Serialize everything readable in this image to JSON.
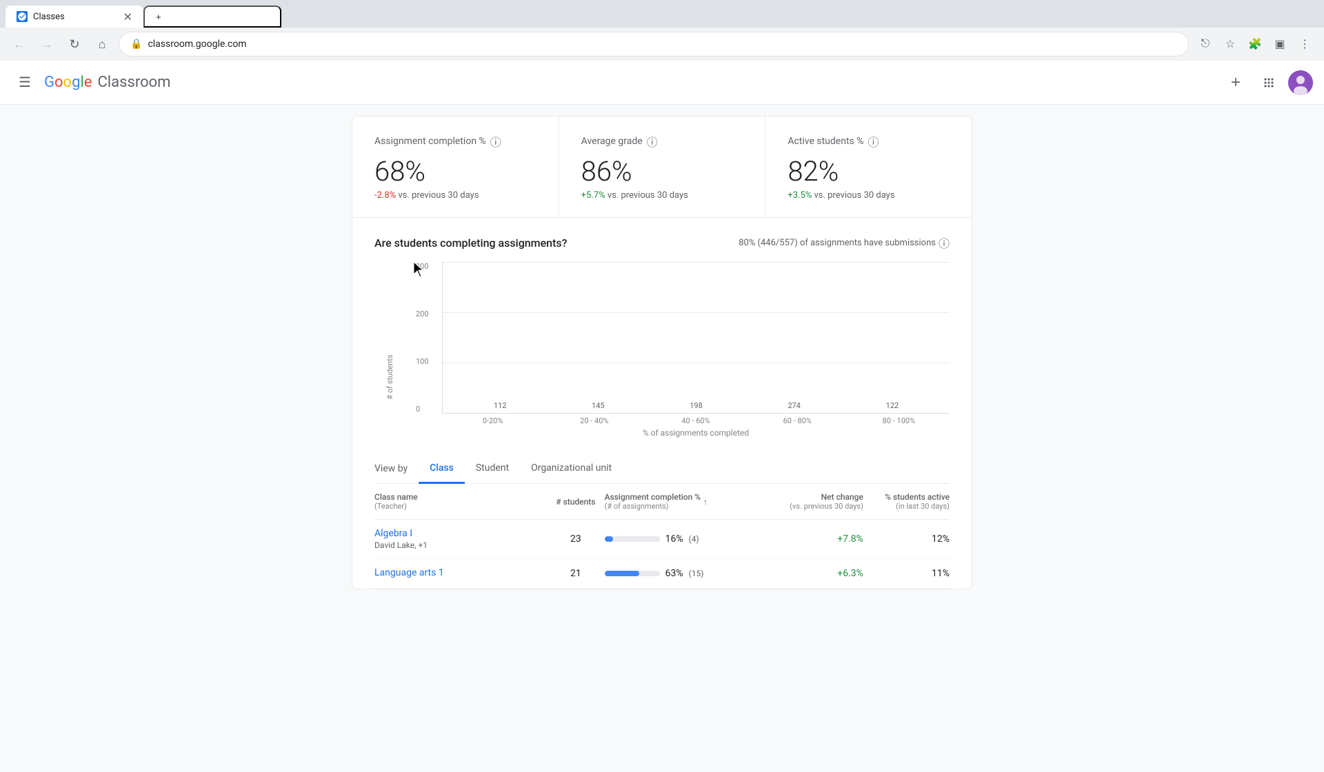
{
  "browser": {
    "tab_title": "Classes",
    "url": "classroom.google.com",
    "favicon_text": "C"
  },
  "header": {
    "logo_google": "Google",
    "logo_classroom": "Classroom",
    "add_button_label": "+",
    "avatar_initials": "👤"
  },
  "stats": [
    {
      "label": "Assignment completion %",
      "value": "68%",
      "change": "-2.8%",
      "change_type": "negative",
      "change_suffix": " vs. previous 30 days"
    },
    {
      "label": "Average grade",
      "value": "86%",
      "change": "+5.7%",
      "change_type": "positive",
      "change_suffix": " vs. previous 30 days"
    },
    {
      "label": "Active students %",
      "value": "82%",
      "change": "+3.5%",
      "change_type": "positive",
      "change_suffix": " vs. previous 30 days"
    }
  ],
  "chart": {
    "title": "Are students completing assignments?",
    "subtitle": "80% (446/557) of assignments have submissions",
    "y_axis_title": "# of students",
    "x_axis_title": "% of assignments completed",
    "y_labels": [
      "0",
      "100",
      "200",
      "300"
    ],
    "bars": [
      {
        "label": "0-20%",
        "value": 112,
        "height_pct": 37
      },
      {
        "label": "20 - 40%",
        "value": 145,
        "height_pct": 48
      },
      {
        "label": "40 - 60%",
        "value": 198,
        "height_pct": 66
      },
      {
        "label": "60 - 80%",
        "value": 274,
        "height_pct": 91
      },
      {
        "label": "80 - 100%",
        "value": 122,
        "height_pct": 41
      }
    ]
  },
  "view_by": {
    "label": "View by",
    "tabs": [
      {
        "label": "Class",
        "active": true
      },
      {
        "label": "Student",
        "active": false
      },
      {
        "label": "Organizational unit",
        "active": false
      }
    ]
  },
  "table": {
    "headers": {
      "class_name": "Class name",
      "class_name_sub": "(Teacher)",
      "students": "# students",
      "assignment": "Assignment completion %",
      "assignment_sub": "(# of assignments)",
      "net_change": "Net change",
      "net_change_sub": "(vs. previous 30 days)",
      "active": "% students active",
      "active_sub": "(in last 30 days)"
    },
    "rows": [
      {
        "class_name": "Algebra I",
        "teacher": "David Lake, +1",
        "students": 23,
        "assignment_pct": "16%",
        "assignment_count": "(4)",
        "progress_pct": 16,
        "net_change": "+7.8%",
        "net_change_type": "positive",
        "active_pct": "12%"
      },
      {
        "class_name": "Language arts 1",
        "teacher": "",
        "students": 21,
        "assignment_pct": "63%",
        "assignment_count": "(15)",
        "progress_pct": 63,
        "net_change": "+6.3%",
        "net_change_type": "positive",
        "active_pct": "11%"
      }
    ]
  }
}
